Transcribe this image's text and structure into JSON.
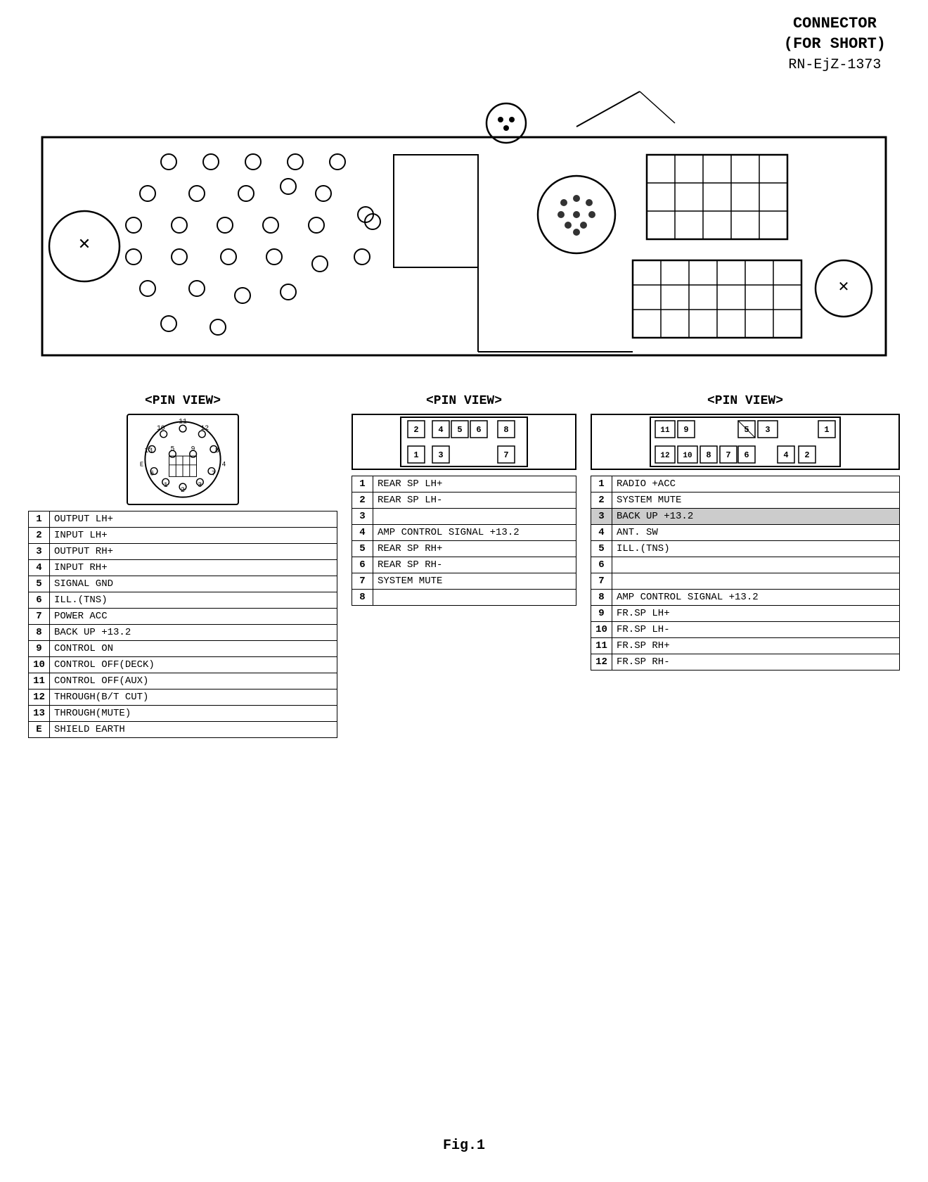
{
  "header": {
    "title": "CONNECTOR",
    "subtitle1": "(FOR SHORT)",
    "subtitle2": "RN-EjZ-1373"
  },
  "fig_label": "Fig.1",
  "pin_view_left": {
    "title": "<PIN VIEW>",
    "pins": [
      {
        "num": "1",
        "label": "OUTPUT  LH+"
      },
      {
        "num": "2",
        "label": "INPUT  LH+"
      },
      {
        "num": "3",
        "label": "OUTPUT  RH+"
      },
      {
        "num": "4",
        "label": "INPUT  RH+"
      },
      {
        "num": "5",
        "label": "SIGNAL  GND"
      },
      {
        "num": "6",
        "label": "ILL.(TNS)"
      },
      {
        "num": "7",
        "label": "POWER  ACC"
      },
      {
        "num": "8",
        "label": "BACK UP +13.2"
      },
      {
        "num": "9",
        "label": "CONTROL  ON"
      },
      {
        "num": "10",
        "label": "CONTROL OFF(DECK)"
      },
      {
        "num": "11",
        "label": "CONTROL OFF(AUX)"
      },
      {
        "num": "12",
        "label": "THROUGH(B/T CUT)"
      },
      {
        "num": "13",
        "label": "THROUGH(MUTE)"
      },
      {
        "num": "E",
        "label": "SHIELD  EARTH"
      }
    ]
  },
  "pin_view_center": {
    "title": "<PIN VIEW>",
    "pins": [
      {
        "num": "1",
        "label": "REAR SP LH+"
      },
      {
        "num": "2",
        "label": "REAR SP LH-"
      },
      {
        "num": "3",
        "label": ""
      },
      {
        "num": "4",
        "label": "AMP CONTROL SIGNAL +13.2"
      },
      {
        "num": "5",
        "label": "REAR SP RH+"
      },
      {
        "num": "6",
        "label": "REAR SP RH-"
      },
      {
        "num": "7",
        "label": "SYSTEM MUTE"
      },
      {
        "num": "8",
        "label": ""
      }
    ]
  },
  "pin_view_right": {
    "title": "<PIN VIEW>",
    "pins": [
      {
        "num": "1",
        "label": "RADIO  +ACC"
      },
      {
        "num": "2",
        "label": "SYSTEM MUTE"
      },
      {
        "num": "3",
        "label": "BACK UP +13.2",
        "highlight": true
      },
      {
        "num": "4",
        "label": "ANT.  SW"
      },
      {
        "num": "5",
        "label": "ILL.(TNS)"
      },
      {
        "num": "6",
        "label": ""
      },
      {
        "num": "7",
        "label": ""
      },
      {
        "num": "8",
        "label": "AMP CONTROL SIGNAL +13.2"
      },
      {
        "num": "9",
        "label": "FR.SP  LH+"
      },
      {
        "num": "10",
        "label": "FR.SP  LH-"
      },
      {
        "num": "11",
        "label": "FR.SP  RH+"
      },
      {
        "num": "12",
        "label": "FR.SP  RH-"
      }
    ]
  }
}
